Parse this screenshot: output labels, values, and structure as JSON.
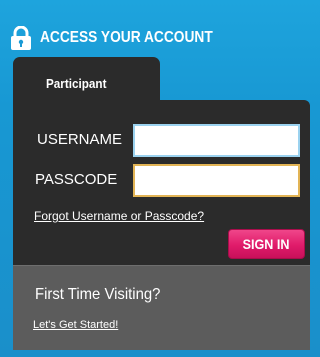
{
  "header": {
    "icon": "lock-icon",
    "title": "ACCESS YOUR ACCOUNT"
  },
  "tabs": [
    {
      "label": "Participant",
      "active": true
    }
  ],
  "login": {
    "username_label": "USERNAME",
    "username_value": "",
    "passcode_label": "PASSCODE",
    "passcode_value": "",
    "forgot_link": "Forgot Username or Passcode?",
    "signin_label": "SIGN IN"
  },
  "first_visit": {
    "title": "First Time Visiting?",
    "link": "Let's Get Started!"
  },
  "colors": {
    "background": "#1a9ad5",
    "panel": "#2b2b2b",
    "footer_panel": "#5c5c5c",
    "signin_button": "#e01b6a",
    "username_border": "#9bd2ef",
    "passcode_border": "#e2b455"
  }
}
